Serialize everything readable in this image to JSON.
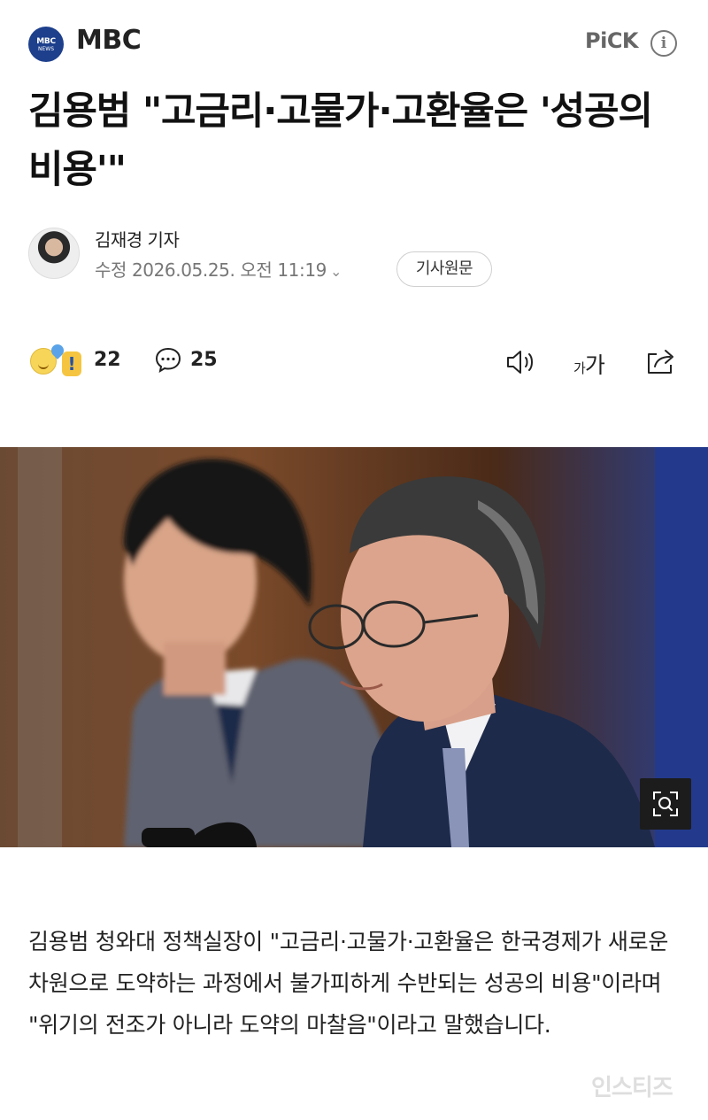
{
  "header": {
    "press_logo_line1": "MBC",
    "press_logo_line2": "NEWS",
    "press_name": "MBC",
    "pick_label": "PiCK",
    "info_icon": "i"
  },
  "article": {
    "headline": "김용범 \"고금리·고물가·고환율은 '성공의 비용'\"",
    "author": "김재경 기자",
    "date_line": "수정 2026.05.25. 오전 11:19",
    "original_button": "기사원문",
    "body": "김용범 청와대 정책실장이 \"고금리·고물가·고환율은 한국경제가 새로운 차원으로 도약하는 과정에서 불가피하게 수반되는 성공의 비용\"이라며 \"위기의 전조가 아니라 도약의 마찰음\"이라고 말했습니다."
  },
  "actions": {
    "reaction_count": "22",
    "comment_count": "25",
    "fontsize_small": "가",
    "fontsize_big": "가"
  },
  "photo": {
    "zoom_icon": "zoom-icon"
  },
  "watermark": "인스티즈",
  "colors": {
    "press_logo_bg": "#1d3f8c",
    "text_primary": "#111111",
    "text_muted": "#777777",
    "photo_background": "#5a3520",
    "suit_navy": "#1e2a4a"
  }
}
